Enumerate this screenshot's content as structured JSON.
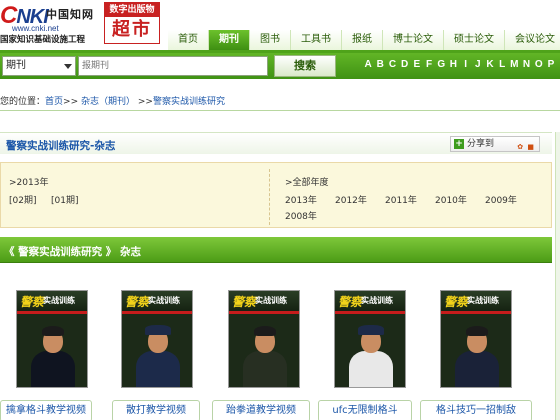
{
  "logo": {
    "main_c": "C",
    "main": "NKI",
    "cn": "中国知网",
    "url": "www.cnki.net",
    "sub": "国家知识基础设施工程"
  },
  "market": {
    "top": "数字出版物",
    "big": "超市"
  },
  "nav": {
    "items": [
      {
        "label": "首页"
      },
      {
        "label": "期刊",
        "active": true
      },
      {
        "label": "图书"
      },
      {
        "label": "工具书"
      },
      {
        "label": "报纸"
      },
      {
        "label": "博士论文"
      },
      {
        "label": "硕士论文"
      },
      {
        "label": "会议论文"
      }
    ]
  },
  "search": {
    "category": "期刊",
    "placeholder": "报期刊",
    "button": "搜索",
    "letters": [
      "A",
      "B",
      "C",
      "D",
      "E",
      "F",
      "G",
      "H",
      "I",
      "J",
      "K",
      "L",
      "M",
      "N",
      "O",
      "P"
    ]
  },
  "breadcrumb": {
    "prefix": "您的位置：",
    "home": "首页",
    "sep1": ">>",
    "level2": "杂志（期刊）",
    "sep2": ">>",
    "current": "警察实战训练研究"
  },
  "journal": {
    "title": "警察实战训练研究-杂志",
    "share": "分享到"
  },
  "years": {
    "left_year": ">2013年",
    "issues": [
      "[02期]",
      "[01期]"
    ],
    "all_years": ">全部年度",
    "list": [
      "2013年",
      "2012年",
      "2011年",
      "2010年",
      "2009年",
      "2008年"
    ]
  },
  "section": {
    "title": "《 警察实战训练研究 》 杂志"
  },
  "covers": [
    {
      "masthead": "警察",
      "masthead2": "实战训练",
      "uniform": "#0f1420",
      "cap": false
    },
    {
      "masthead": "警察",
      "masthead2": "实战训练",
      "uniform": "#1c2a4a",
      "cap": true
    },
    {
      "masthead": "警察",
      "masthead2": "实战训练",
      "uniform": "#272f22",
      "cap": false
    },
    {
      "masthead": "警察",
      "masthead2": "实战训练",
      "uniform": "#e8e8e8",
      "cap": true
    },
    {
      "masthead": "警察",
      "masthead2": "实战训练",
      "uniform": "#1a2238",
      "cap": false
    }
  ],
  "chips": [
    {
      "label": "擒拿格斗教学视频"
    },
    {
      "label": "散打教学视频"
    },
    {
      "label": "跆拳道教学视频"
    },
    {
      "label": "ufc无限制格斗"
    },
    {
      "label": "格斗技巧一招制敌"
    }
  ],
  "colors": {
    "nav_active": "#3e8f12",
    "link": "#1b56a8",
    "brand_red": "#c82121"
  }
}
